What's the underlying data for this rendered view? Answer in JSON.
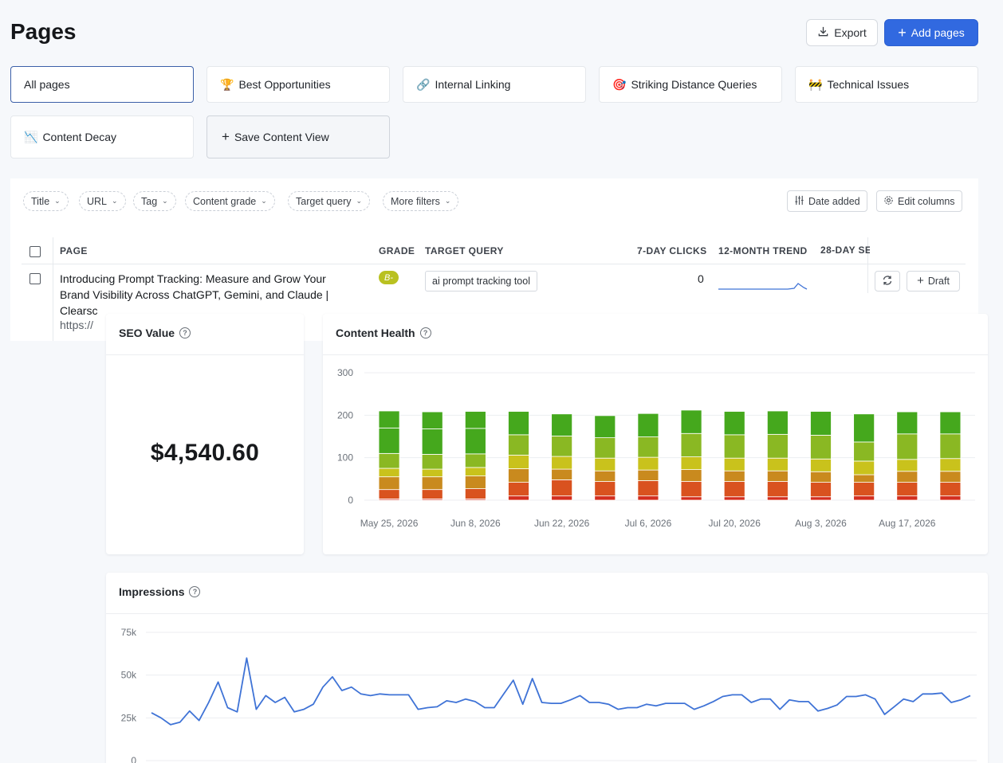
{
  "page": {
    "title": "Pages"
  },
  "header": {
    "export_label": "Export",
    "add_label": "Add pages"
  },
  "views": [
    {
      "label": "All pages",
      "emoji": ""
    },
    {
      "label": "Best Opportunities",
      "emoji": "🏆"
    },
    {
      "label": "Internal Linking",
      "emoji": "🔗"
    },
    {
      "label": "Striking Distance Queries",
      "emoji": "🎯"
    },
    {
      "label": "Technical Issues",
      "emoji": "🚧"
    },
    {
      "label": "Content Decay",
      "emoji": "📉"
    }
  ],
  "save_view_label": "Save Content View",
  "filters": [
    "Title",
    "URL",
    "Tag",
    "Content grade",
    "Target query",
    "More filters"
  ],
  "toolbar": {
    "date_added": "Date added",
    "edit_columns": "Edit columns"
  },
  "table": {
    "columns": [
      "PAGE",
      "GRADE",
      "TARGET QUERY",
      "7-DAY CLICKS",
      "12-MONTH TREND",
      "28-DAY SE"
    ],
    "row": {
      "title": "Introducing Prompt Tracking: Measure and Grow Your Brand Visibility Across ChatGPT, Gemini, and Claude | Clearsc",
      "url": "https://",
      "grade": "B-",
      "target_query": "ai prompt tracking tool",
      "clicks": "0",
      "draft_label": "Draft"
    }
  },
  "seo": {
    "title": "SEO Value",
    "value": "$4,540.60"
  },
  "health": {
    "title": "Content Health"
  },
  "impressions": {
    "title": "Impressions"
  },
  "colors": {
    "accent": "#3169e0",
    "grade_badge": "#b9c121",
    "health_levels": [
      "#d42e1f",
      "#d9521f",
      "#c98a1e",
      "#c9c21c",
      "#8ab823",
      "#45a81d"
    ],
    "line": "#3f73d6"
  },
  "chart_data": [
    {
      "type": "bar",
      "title": "Content Health",
      "stacked": true,
      "ylim": [
        0,
        300
      ],
      "yticks": [
        0,
        100,
        200,
        300
      ],
      "xticks": [
        "May 25, 2026",
        "Jun 8, 2026",
        "Jun 22, 2026",
        "Jul 6, 2026",
        "Jul 20, 2026",
        "Aug 3, 2026",
        "Aug 17, 2026"
      ],
      "categories": [
        "May 25, 2026",
        "Jun 1, 2026",
        "Jun 8, 2026",
        "Jun 15, 2026",
        "Jun 22, 2026",
        "Jun 29, 2026",
        "Jul 6, 2026",
        "Jul 13, 2026",
        "Jul 20, 2026",
        "Jul 27, 2026",
        "Aug 3, 2026",
        "Aug 10, 2026",
        "Aug 17, 2026",
        "Aug 24, 2026"
      ],
      "series": [
        {
          "values": [
            3,
            3,
            3,
            10,
            10,
            10,
            10,
            8,
            8,
            8,
            8,
            10,
            10,
            10
          ]
        },
        {
          "values": [
            22,
            22,
            24,
            32,
            38,
            34,
            36,
            36,
            36,
            36,
            34,
            32,
            32,
            32
          ]
        },
        {
          "values": [
            30,
            30,
            30,
            32,
            25,
            25,
            25,
            28,
            25,
            25,
            25,
            18,
            26,
            26
          ]
        },
        {
          "values": [
            20,
            18,
            20,
            32,
            30,
            30,
            30,
            30,
            30,
            30,
            30,
            32,
            28,
            30
          ]
        },
        {
          "values": [
            35,
            35,
            32,
            48,
            48,
            48,
            48,
            55,
            55,
            56,
            56,
            45,
            60,
            58
          ]
        },
        {
          "values": [
            60,
            60,
            60,
            55,
            52,
            52,
            55,
            55,
            55,
            55,
            56,
            66,
            52,
            52
          ]
        },
        {
          "values": [
            40,
            40,
            40,
            0,
            0,
            0,
            0,
            0,
            0,
            0,
            0,
            0,
            0,
            0
          ]
        }
      ]
    },
    {
      "type": "line",
      "title": "Impressions",
      "ylim": [
        0,
        75000
      ],
      "yticks": [
        "0",
        "25k",
        "50k",
        "75k"
      ],
      "y": [
        28000,
        25000,
        21000,
        22500,
        29000,
        23500,
        34000,
        46000,
        31000,
        28500,
        60000,
        30000,
        38000,
        34000,
        37000,
        28500,
        30000,
        33000,
        43000,
        49000,
        41000,
        43000,
        39000,
        38000,
        39000,
        38500,
        38500,
        38500,
        30000,
        31000,
        31500,
        35000,
        34000,
        36000,
        34500,
        31000,
        31000,
        39000,
        47000,
        33000,
        48000,
        34000,
        33500,
        33500,
        35500,
        38000,
        34000,
        34000,
        33000,
        30000,
        31000,
        31000,
        33000,
        32000,
        33500,
        33500,
        33500,
        30000,
        32000,
        34500,
        37500,
        38500,
        38500,
        34000,
        36000,
        36000,
        30000,
        35500,
        34500,
        34500,
        29000,
        30500,
        32500,
        37500,
        37500,
        38500,
        36000,
        27000,
        31500,
        36000,
        34500,
        39000,
        39000,
        39500,
        34000,
        35500,
        38000
      ]
    }
  ]
}
